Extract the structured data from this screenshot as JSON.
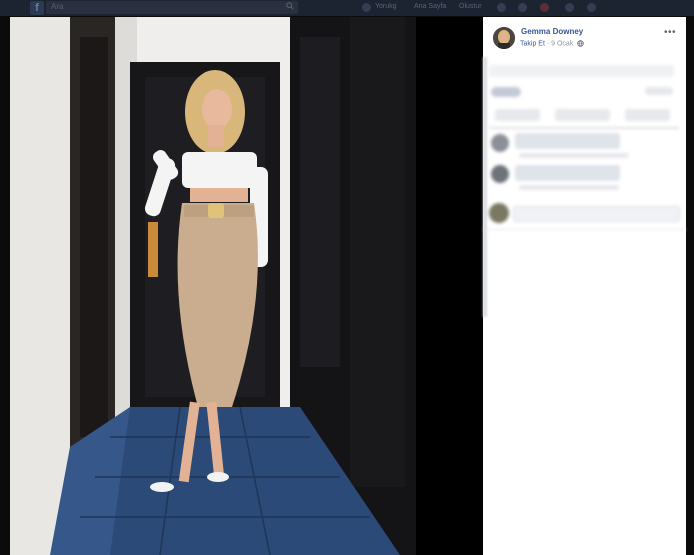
{
  "topbar": {
    "search_placeholder": "Ara",
    "nav": [
      "Yorukg",
      "Ana Sayfa",
      "Olustur"
    ]
  },
  "post": {
    "author": "Gemma Downey",
    "follow_label": "Takip Et",
    "date": "9 Ocak",
    "privacy_icon": "globe-icon",
    "more_label": "•••"
  },
  "colors": {
    "link_blue": "#385898",
    "meta_gray": "#90949c",
    "topbar_bg": "#1c2331"
  }
}
